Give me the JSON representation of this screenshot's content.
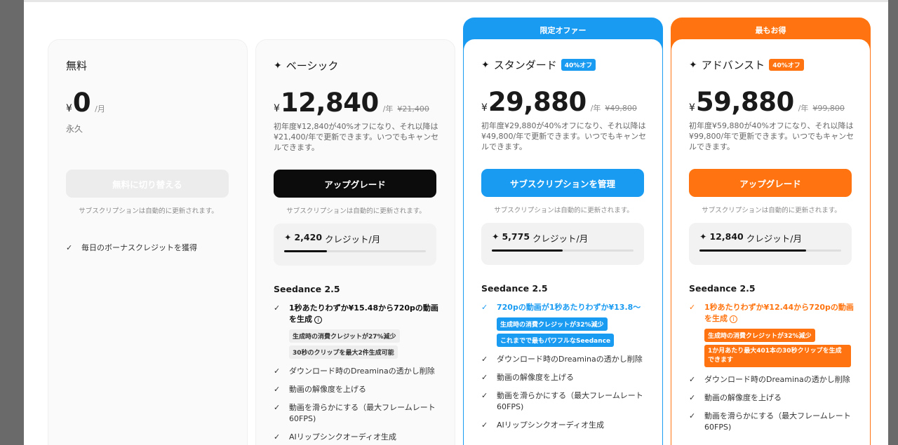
{
  "plans": {
    "free": {
      "name": "無料",
      "price": "0",
      "period": "/月",
      "forever": "永久",
      "button": "無料に切り替える",
      "auto_renew": "サブスクリプションは自動的に更新されます。",
      "features": [
        "毎日のボーナスクレジットを獲得"
      ]
    },
    "basic": {
      "name": "ベーシック",
      "price": "12,840",
      "period": "/年",
      "original": "¥21,400",
      "description": "初年度¥12,840が40%オフになり、それ以降は¥21,400/年で更新できます。いつでもキャンセルできます。",
      "button": "アップグレード",
      "auto_renew": "サブスクリプションは自動的に更新されます。",
      "credits_amount": "2,420",
      "credits_label": "クレジット/月",
      "credits_fill": 0.3,
      "section": "Seedance 2.5",
      "highlight": "1秒あたりわずか¥15.48から720pの動画を生成",
      "tags": [
        "生成時の消費クレジットが27%減少",
        "30秒のクリップを最大2件生成可能"
      ],
      "features": [
        "ダウンロード時のDreaminaの透かし削除",
        "動画の解像度を上げる",
        "動画を滑らかにする（最大フレームレート60FPS)",
        "AIリップシンクオーディオ生成"
      ]
    },
    "standard": {
      "banner": "限定オファー",
      "name": "スタンダード",
      "badge": "40%オフ",
      "price": "29,880",
      "period": "/年",
      "original": "¥49,800",
      "description": "初年度¥29,880が40%オフになり、それ以降は¥49,800/年で更新できます。いつでもキャンセルできます。",
      "button": "サブスクリプションを管理",
      "auto_renew": "サブスクリプションは自動的に更新されます。",
      "credits_amount": "5,775",
      "credits_label": "クレジット/月",
      "credits_fill": 0.5,
      "section": "Seedance 2.5",
      "highlight": "720pの動画が1秒あたりわずか¥13.8〜",
      "tags": [
        "生成時の消費クレジットが32%減少",
        "これまでで最もパワフルなSeedance"
      ],
      "features": [
        "ダウンロード時のDreaminaの透かし削除",
        "動画の解像度を上げる",
        "動画を滑らかにする（最大フレームレート60FPS)",
        "AIリップシンクオーディオ生成"
      ]
    },
    "advanced": {
      "banner": "最もお得",
      "name": "アドバンスト",
      "badge": "40%オフ",
      "price": "59,880",
      "period": "/年",
      "original": "¥99,800",
      "description": "初年度¥59,880が40%オフになり、それ以降は¥99,800/年で更新できます。いつでもキャンセルできます。",
      "button": "アップグレード",
      "auto_renew": "サブスクリプションは自動的に更新されます。",
      "credits_amount": "12,840",
      "credits_label": "クレジット/月",
      "credits_fill": 0.75,
      "section": "Seedance 2.5",
      "highlight": "1秒あたりわずか¥12.44から720pの動画を生成",
      "tags": [
        "生成時の消費クレジットが32%減少",
        "1か月あたり最大401本の30秒クリップを生成できます"
      ],
      "features": [
        "ダウンロード時のDreaminaの透かし削除",
        "動画の解像度を上げる",
        "動画を滑らかにする（最大フレームレート60FPS)"
      ]
    }
  },
  "currency": "¥",
  "colors": {
    "blue": "#1a9bf2",
    "orange": "#ff7410",
    "black": "#0c0c0c"
  }
}
